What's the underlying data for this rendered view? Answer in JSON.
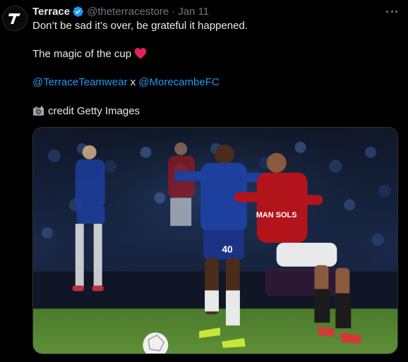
{
  "tweet": {
    "author_name": "Terrace",
    "handle": "@theterracestore",
    "separator": "·",
    "timestamp": "Jan 11",
    "line1": "Don’t be sad it’s over, be grateful it happened.",
    "line2": "The magic of the cup",
    "mention1": "@TerraceTeamwear",
    "joiner": "x",
    "mention2": "@MorecambeFC",
    "credit": "credit Getty Images",
    "icons": {
      "avatar": "terrace-logo-icon",
      "verified": "verified-badge-icon",
      "heart": "red-heart-emoji",
      "camera": "camera-flash-emoji",
      "more": "more-options-icon"
    },
    "colors": {
      "link": "#1d9bf0",
      "verified": "#1d9bf0",
      "heart": "#e0245e",
      "chelsea_kit": "#1d3f9e",
      "morecambe_kit": "#b3141c"
    },
    "media": {
      "shirt_sponsor": "MAN SOLS",
      "player_number": "40"
    }
  }
}
